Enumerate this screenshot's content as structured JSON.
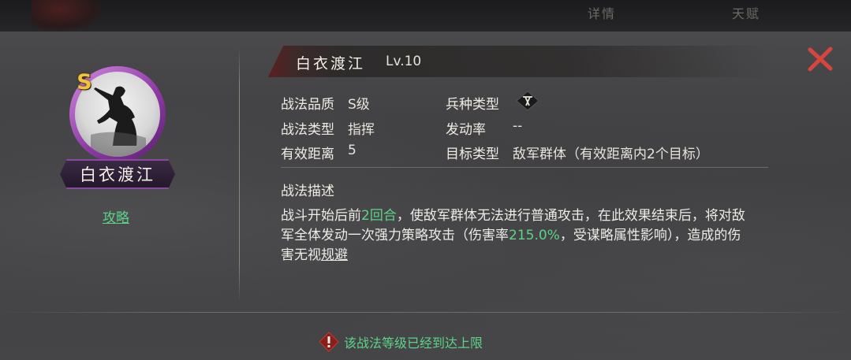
{
  "top_tabs": [
    "详情",
    "天赋"
  ],
  "card": {
    "name": "白衣渡江",
    "grade_badge": "S",
    "strategy_link": "攻略"
  },
  "header": {
    "skill_name": "白衣渡江",
    "level": "Lv.10"
  },
  "attributes": {
    "quality_label": "战法品质",
    "quality_value": "S级",
    "type_label": "战法类型",
    "type_value": "指挥",
    "range_label": "有效距离",
    "range_value": "5",
    "troop_label": "兵种类型",
    "trigger_label": "发动率",
    "trigger_value": "--",
    "target_label": "目标类型",
    "target_value": "敌军群体（有效距离内2个目标）"
  },
  "description": {
    "title": "战法描述",
    "line1_a": "战斗开始后前",
    "line1_hl": "2回合",
    "line1_b": "，使敌军群体无法进行普通攻击，在此效果结束后，将对敌",
    "line2_a": "军全体发动一次强力策略攻击（伤害率",
    "line2_hl": "215.0%",
    "line2_b": "，受谋略属性影响），造成的伤",
    "line3_a": "害无视",
    "line3_ul": "规避"
  },
  "footer": {
    "message": "该战法等级已经到达上限"
  },
  "colors": {
    "highlight": "#5dd38a",
    "grade": "#f3c23a",
    "ring": "#8e3aa6",
    "close": "#d8453f"
  }
}
